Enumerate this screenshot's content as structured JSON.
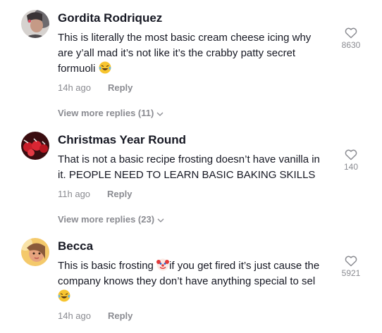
{
  "comments": [
    {
      "author": "Gordita Rodriquez",
      "text_before": "This is literally the most basic cream cheese icing why are y’all mad it’s not like it’s the crabby patty secret formuoli",
      "emoji_end": "laughing-tears-emoji",
      "time": "14h ago",
      "reply_label": "Reply",
      "likes": "8630",
      "view_more": "View more replies (11)"
    },
    {
      "author": "Christmas Year Round",
      "text_before": "That is not a basic recipe frosting doesn’t have vanilla in it. PEOPLE NEED TO LEARN BASIC BAKING SKILLS",
      "time": "11h ago",
      "reply_label": "Reply",
      "likes": "140",
      "view_more": "View more replies (23)"
    },
    {
      "author": "Becca",
      "text_before": "This is basic frosting ",
      "emoji_mid": "clown-emoji",
      "text_after": "if you get fired it’s just cause the company knows they don’t have anything special to sel ",
      "emoji_end": "laughing-tears-emoji",
      "time": "14h ago",
      "reply_label": "Reply",
      "likes": "5921"
    }
  ],
  "colors": {
    "muted": "#8a8b91",
    "text": "#161823",
    "background": "#ffffff"
  }
}
